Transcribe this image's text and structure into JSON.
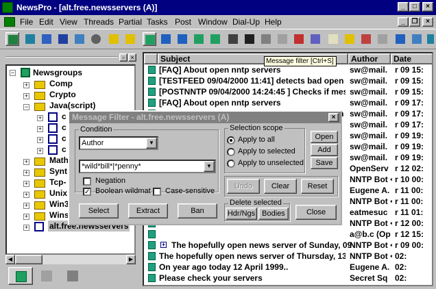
{
  "window": {
    "title": "NewsPro - [alt.free.newsservers (A)]"
  },
  "menu": [
    {
      "label": "File"
    },
    {
      "label": "Edit"
    },
    {
      "label": "View"
    },
    {
      "label": "Threads"
    },
    {
      "label": "Partial"
    },
    {
      "label": "Tasks"
    },
    {
      "label": "Post"
    },
    {
      "label": "Window"
    },
    {
      "label": "Dial-Up"
    },
    {
      "label": "Help"
    }
  ],
  "tooltip": "Message filter [Ctrl+S]",
  "tree": {
    "root": "Newsgroups",
    "items": [
      {
        "label": "Comp"
      },
      {
        "label": "Crypto"
      },
      {
        "label": "Java(script)"
      },
      {
        "label": "c"
      },
      {
        "label": "c"
      },
      {
        "label": "c"
      },
      {
        "label": "c"
      },
      {
        "label": "Math"
      },
      {
        "label": "Synt"
      },
      {
        "label": "Tcp-"
      },
      {
        "label": "Unix"
      },
      {
        "label": "Win3"
      },
      {
        "label": "Wins"
      },
      {
        "label": "alt.free.newsservers"
      }
    ]
  },
  "columns": {
    "subject": "Subject",
    "author": "Author",
    "date": "Date"
  },
  "messages": [
    {
      "subject": "[FAQ] About open nntp servers",
      "author": "sw@mail.",
      "date": "r 09 15:"
    },
    {
      "subject": "[TESTFEED 09/04/2000 11:41] detects bad open nnt",
      "author": "sw@mail.",
      "date": "r 09 15:"
    },
    {
      "subject": "[POSTNNTP 09/04/2000 14:24:45 ] Checks if messag",
      "author": "sw@mail.",
      "date": "r 09 15:"
    },
    {
      "subject": "[FAQ] About open nntp servers",
      "author": "sw@mail.",
      "date": "r 09 17:"
    },
    {
      "subject": "[TESTFEED 09/04/2000 11:41] detects bad open",
      "author": "sw@mail.",
      "date": "r 09 17:"
    },
    {
      "subject": "",
      "author": "sw@mail.",
      "date": "r 09 17:"
    },
    {
      "subject": "",
      "author": "sw@mail.",
      "date": "r 09 19:"
    },
    {
      "subject": "",
      "author": "sw@mail.",
      "date": "r 09 19:"
    },
    {
      "subject": "",
      "author": "sw@mail.",
      "date": "r 09 19:"
    },
    {
      "subject": "",
      "author": "OpenServ",
      "date": "r 12 02:"
    },
    {
      "subject": "",
      "author": "NNTP Bot <",
      "date": "r 10 00:"
    },
    {
      "subject": "",
      "author": "Eugene A.",
      "date": "r 11 00:"
    },
    {
      "subject": "",
      "author": "NNTP Bot <",
      "date": "r 11 00:"
    },
    {
      "subject": "",
      "author": "eatmesuc",
      "date": "r 11 01:"
    },
    {
      "subject": "",
      "author": "NNTP Bot <",
      "date": "r 12 00:"
    },
    {
      "subject": "",
      "author": "a@b.c (Op",
      "date": "r 12 15:"
    },
    {
      "subject": "The hopefully open news server of Sunday, 09",
      "author": "NNTP Bot <",
      "date": "r 09 00:"
    },
    {
      "subject": "The hopefully open news server of Thursday, 13",
      "author": "NNTP Bot <",
      "date": "02:"
    },
    {
      "subject": "On year ago today 12 April 1999..",
      "author": "Eugene A.",
      "date": "02:"
    },
    {
      "subject": "Please check your servers",
      "author": "Secret Sq",
      "date": "02:"
    }
  ],
  "dialog": {
    "title": "Message Filter - alt.free.newsservers (A)",
    "condition_label": "Condition",
    "field_value": "Author",
    "pattern_value": "*wild*bill*|*penny*",
    "negation_label": "Negation",
    "negation_checked": false,
    "boolean_label": "Boolean wildmat",
    "boolean_checked": true,
    "case_label": "Case-sensitive",
    "case_checked": false,
    "scope_label": "Selection scope",
    "scope_all": "Apply to all",
    "scope_selected": "Apply to selected",
    "scope_unselected": "Apply to unselected",
    "scope_value": "all",
    "open_btn": "Open",
    "add_btn": "Add",
    "save_btn": "Save",
    "undo_btn": "Undo",
    "clear_btn": "Clear",
    "reset_btn": "Reset",
    "delete_label": "Delete selected",
    "hdr_btn": "Hdr/Ngs",
    "bodies_btn": "Bodies",
    "select_btn": "Select",
    "extract_btn": "Extract",
    "ban_btn": "Ban",
    "close_btn": "Close"
  }
}
